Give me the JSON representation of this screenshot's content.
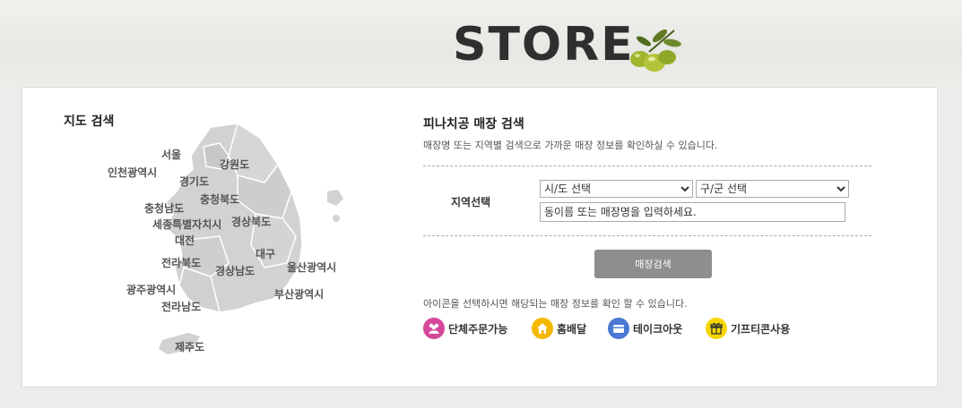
{
  "header": {
    "title": "STORE"
  },
  "map": {
    "title": "지도 검색",
    "regions": [
      "서울",
      "인천광역시",
      "경기도",
      "강원도",
      "충청북도",
      "충청남도",
      "세종특별자치시",
      "경상북도",
      "대전",
      "대구",
      "전라북도",
      "경상남도",
      "울산광역시",
      "광주광역시",
      "부산광역시",
      "전라남도",
      "제주도"
    ]
  },
  "search": {
    "title": "피나치공 매장 검색",
    "description": "매장명 또는 지역별 검색으로 가까운 매장 정보를 확인하실 수 있습니다.",
    "region_label": "지역선택",
    "city_select": "시/도 선택",
    "gu_select": "구/군 선택",
    "input_placeholder": "동이름 또는 매장명을 입력하세요.",
    "button_label": "매장검색"
  },
  "legend": {
    "description": "아이콘을 선택하시면 해당되는 매장 정보를 확인 할 수 있습니다.",
    "items": [
      {
        "label": "단체주문가능",
        "icon": "group-icon",
        "color": "#d6479a"
      },
      {
        "label": "홈배달",
        "icon": "home-icon",
        "color": "#f5b800"
      },
      {
        "label": "테이크아웃",
        "icon": "takeout-icon",
        "color": "#4a78d4"
      },
      {
        "label": "기프티콘사용",
        "icon": "gift-icon",
        "color": "#f7d600"
      }
    ]
  },
  "colors": {
    "map_fill": "#d2d2d2",
    "button": "#8e8e8e"
  }
}
